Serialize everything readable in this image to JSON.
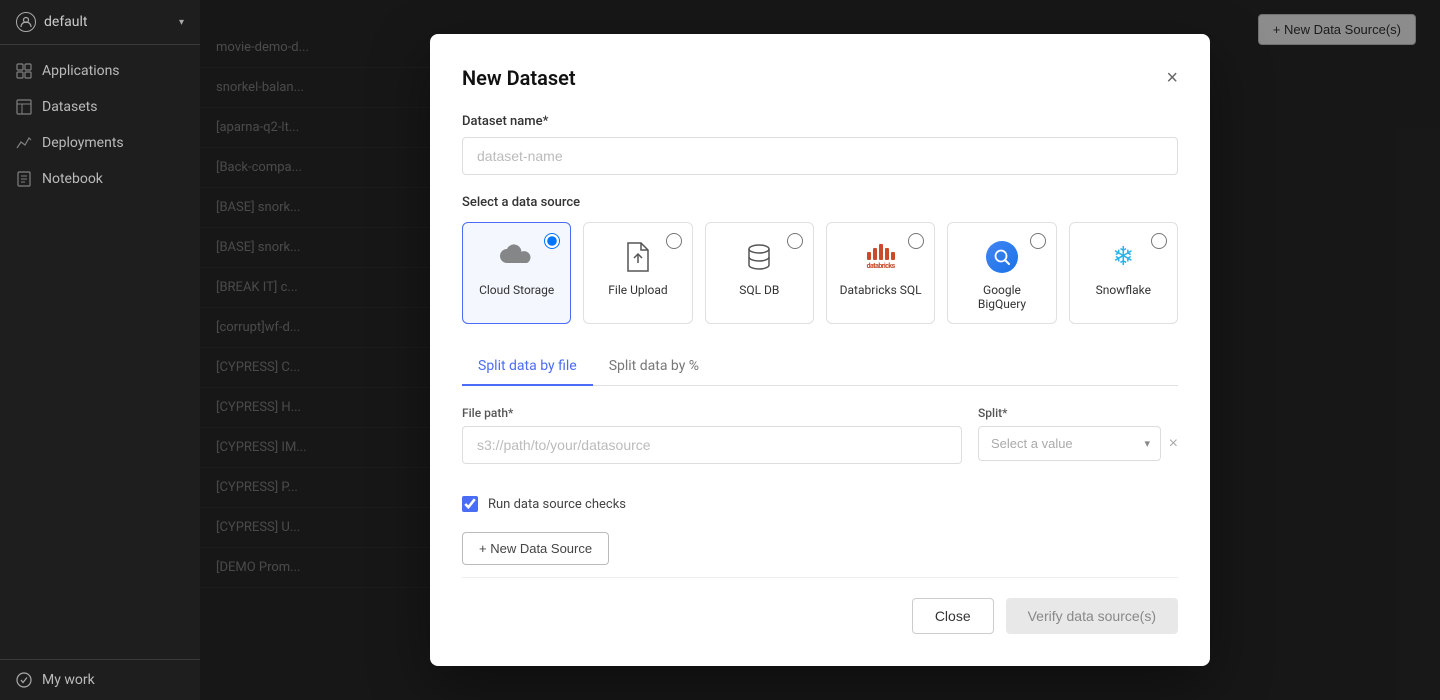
{
  "sidebar": {
    "account": {
      "name": "default",
      "chevron": "▾"
    },
    "nav_items": [
      {
        "id": "applications",
        "label": "Applications",
        "icon": "grid"
      },
      {
        "id": "datasets",
        "label": "Datasets",
        "icon": "table"
      },
      {
        "id": "deployments",
        "label": "Deployments",
        "icon": "chart"
      },
      {
        "id": "notebook",
        "label": "Notebook",
        "icon": "doc"
      }
    ],
    "footer": {
      "label": "My work",
      "icon": "circle-check"
    }
  },
  "background": {
    "list_items": [
      "movie-demo-d...",
      "snorkel-balan...",
      "[aparna-q2-lt...",
      "[Back-compa...",
      "[BASE] snork...",
      "[BASE] snork...",
      "[BREAK IT] c...",
      "[corrupt]wf-d...",
      "[CYPRESS] C...",
      "[CYPRESS] H...",
      "[CYPRESS] IM...",
      "[CYPRESS] P...",
      "[CYPRESS] U...",
      "[DEMO Prom..."
    ],
    "new_datasource_btn": "+ New Data Source(s)"
  },
  "modal": {
    "title": "New Dataset",
    "close_label": "×",
    "dataset_name_label": "Dataset name*",
    "dataset_name_placeholder": "dataset-name",
    "select_datasource_label": "Select a data source",
    "datasources": [
      {
        "id": "cloud_storage",
        "label": "Cloud Storage",
        "selected": true
      },
      {
        "id": "file_upload",
        "label": "File Upload",
        "selected": false
      },
      {
        "id": "sql_db",
        "label": "SQL DB",
        "selected": false
      },
      {
        "id": "databricks_sql",
        "label": "Databricks SQL",
        "selected": false
      },
      {
        "id": "google_bigquery",
        "label": "Google BigQuery",
        "selected": false
      },
      {
        "id": "snowflake",
        "label": "Snowflake",
        "selected": false
      }
    ],
    "tabs": [
      {
        "id": "split_by_file",
        "label": "Split data by file",
        "active": true
      },
      {
        "id": "split_by_pct",
        "label": "Split data by %",
        "active": false
      }
    ],
    "file_path_label": "File path*",
    "file_path_placeholder": "s3://path/to/your/datasource",
    "split_label": "Split*",
    "split_placeholder": "Select a value",
    "run_checks_label": "Run data source checks",
    "run_checks_checked": true,
    "add_datasource_btn": "+ New Data Source",
    "footer": {
      "close_btn": "Close",
      "verify_btn": "Verify data source(s)"
    }
  }
}
